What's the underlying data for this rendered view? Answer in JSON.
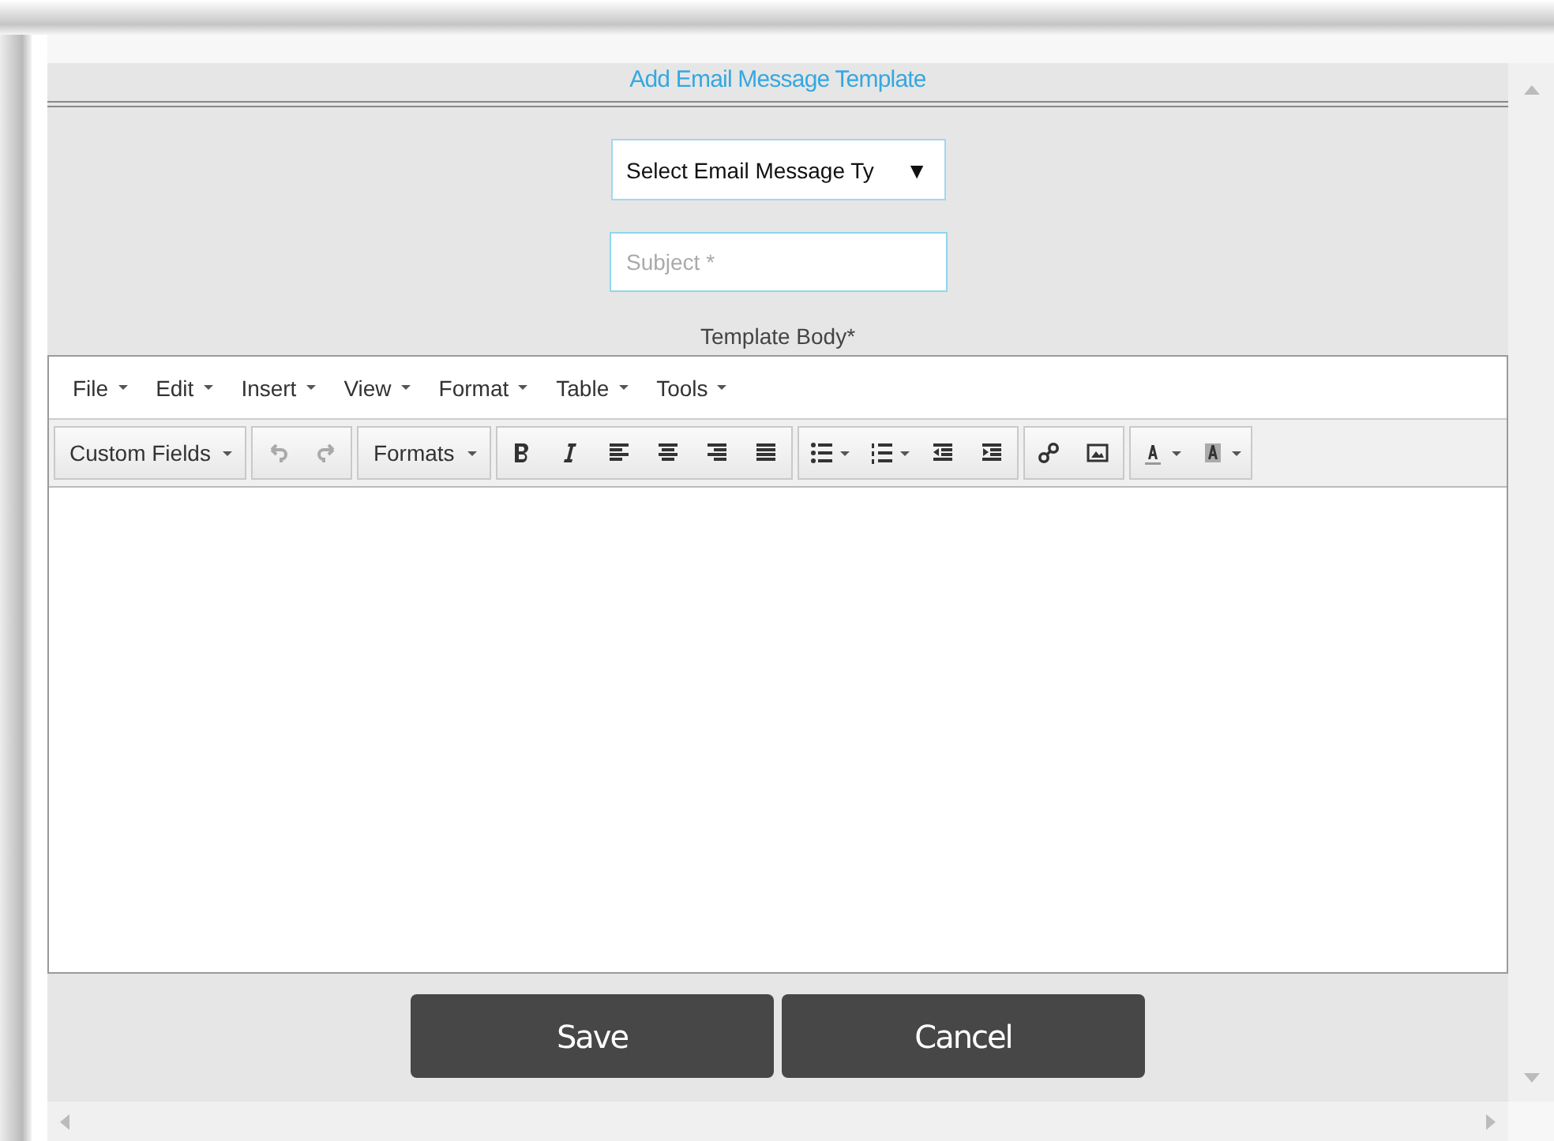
{
  "dialog": {
    "title": "Add Email Message Template"
  },
  "type_select": {
    "value": "Select Email Message Ty",
    "arrow": "▼"
  },
  "subject": {
    "placeholder": "Subject *"
  },
  "body_label": "Template Body*",
  "editor": {
    "menus": [
      "File",
      "Edit",
      "Insert",
      "View",
      "Format",
      "Table",
      "Tools"
    ],
    "toolbar": [
      [
        {
          "kind": "text-dropdown",
          "label": "Custom Fields",
          "disabled": false
        }
      ],
      [
        {
          "kind": "undo",
          "disabled": true
        },
        {
          "kind": "redo",
          "disabled": true
        }
      ],
      [
        {
          "kind": "text-dropdown",
          "label": "Formats",
          "disabled": false
        }
      ],
      [
        {
          "kind": "bold",
          "disabled": false
        },
        {
          "kind": "italic",
          "disabled": false
        },
        {
          "kind": "align-left",
          "disabled": false
        },
        {
          "kind": "align-center",
          "disabled": false
        },
        {
          "kind": "align-right",
          "disabled": false
        },
        {
          "kind": "justify",
          "disabled": false
        }
      ],
      [
        {
          "kind": "bullet-list",
          "disabled": false
        },
        {
          "kind": "numbered-list",
          "disabled": false
        },
        {
          "kind": "outdent",
          "disabled": false
        },
        {
          "kind": "indent",
          "disabled": false
        }
      ],
      [
        {
          "kind": "link",
          "disabled": false
        },
        {
          "kind": "image",
          "disabled": false
        }
      ],
      [
        {
          "kind": "text-color",
          "disabled": false
        },
        {
          "kind": "background-color",
          "disabled": false
        }
      ]
    ]
  },
  "buttons": [
    "Save",
    "Cancel"
  ]
}
